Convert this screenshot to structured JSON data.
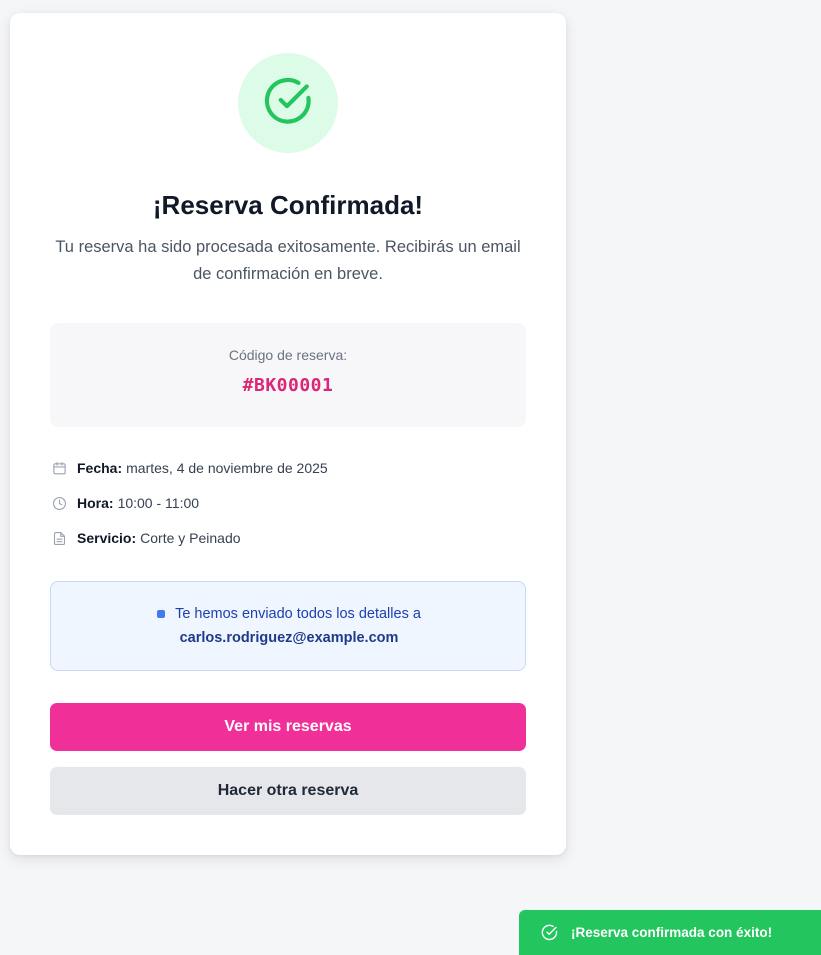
{
  "confirmation": {
    "title": "¡Reserva Confirmada!",
    "subtitle": "Tu reserva ha sido procesada exitosamente. Recibirás un email de confirmación en breve.",
    "icon": "check-circle-icon"
  },
  "booking_code": {
    "label": "Código de reserva:",
    "value": "#BK00001"
  },
  "details": {
    "date_label": "Fecha:",
    "date_value": "martes, 4 de noviembre de 2025",
    "time_label": "Hora:",
    "time_value": "10:00 - 11:00",
    "service_label": "Servicio:",
    "service_value": "Corte y Peinado"
  },
  "email_notice": {
    "text": "Te hemos enviado todos los detalles a",
    "email": "carlos.rodriguez@example.com"
  },
  "buttons": {
    "view_bookings": "Ver mis reservas",
    "new_booking": "Hacer otra reserva"
  },
  "toast": {
    "message": "¡Reserva confirmada con éxito!"
  },
  "colors": {
    "primary": "#f12f98",
    "success": "#22c55e",
    "code": "#db2777"
  }
}
